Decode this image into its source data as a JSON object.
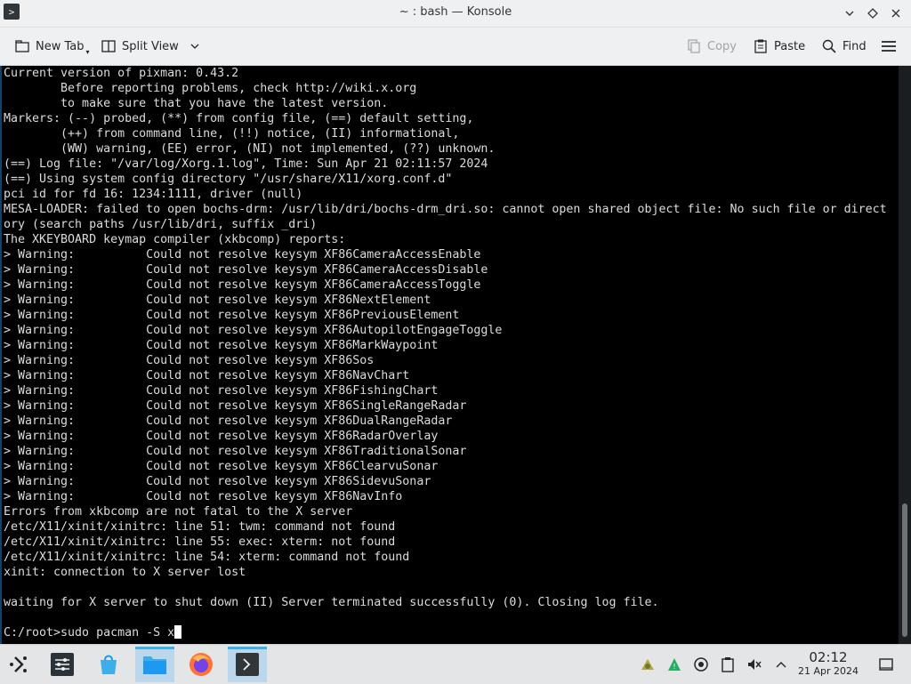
{
  "window": {
    "title": "~ : bash — Konsole",
    "app_icon": "terminal-icon"
  },
  "toolbar": {
    "new_tab": "New Tab",
    "split_view": "Split View",
    "copy": "Copy",
    "paste": "Paste",
    "find": "Find"
  },
  "terminal": {
    "lines": [
      "Current version of pixman: 0.43.2",
      "        Before reporting problems, check http://wiki.x.org",
      "        to make sure that you have the latest version.",
      "Markers: (--) probed, (**) from config file, (==) default setting,",
      "        (++) from command line, (!!) notice, (II) informational,",
      "        (WW) warning, (EE) error, (NI) not implemented, (??) unknown.",
      "(==) Log file: \"/var/log/Xorg.1.log\", Time: Sun Apr 21 02:11:57 2024",
      "(==) Using system config directory \"/usr/share/X11/xorg.conf.d\"",
      "pci id for fd 16: 1234:1111, driver (null)",
      "MESA-LOADER: failed to open bochs-drm: /usr/lib/dri/bochs-drm_dri.so: cannot open shared object file: No such file or direct",
      "ory (search paths /usr/lib/dri, suffix _dri)",
      "The XKEYBOARD keymap compiler (xkbcomp) reports:",
      "> Warning:          Could not resolve keysym XF86CameraAccessEnable",
      "> Warning:          Could not resolve keysym XF86CameraAccessDisable",
      "> Warning:          Could not resolve keysym XF86CameraAccessToggle",
      "> Warning:          Could not resolve keysym XF86NextElement",
      "> Warning:          Could not resolve keysym XF86PreviousElement",
      "> Warning:          Could not resolve keysym XF86AutopilotEngageToggle",
      "> Warning:          Could not resolve keysym XF86MarkWaypoint",
      "> Warning:          Could not resolve keysym XF86Sos",
      "> Warning:          Could not resolve keysym XF86NavChart",
      "> Warning:          Could not resolve keysym XF86FishingChart",
      "> Warning:          Could not resolve keysym XF86SingleRangeRadar",
      "> Warning:          Could not resolve keysym XF86DualRangeRadar",
      "> Warning:          Could not resolve keysym XF86RadarOverlay",
      "> Warning:          Could not resolve keysym XF86TraditionalSonar",
      "> Warning:          Could not resolve keysym XF86ClearvuSonar",
      "> Warning:          Could not resolve keysym XF86SidevuSonar",
      "> Warning:          Could not resolve keysym XF86NavInfo",
      "Errors from xkbcomp are not fatal to the X server",
      "/etc/X11/xinit/xinitrc: line 51: twm: command not found",
      "/etc/X11/xinit/xinitrc: line 55: exec: xterm: not found",
      "/etc/X11/xinit/xinitrc: line 54: xterm: command not found",
      "xinit: connection to X server lost",
      "",
      "waiting for X server to shut down (II) Server terminated successfully (0). Closing log file.",
      ""
    ],
    "prompt": "C:/root>sudo pacman -S x"
  },
  "taskbar": {
    "items": [
      "app-launcher-icon",
      "settings-icon",
      "discover-store-icon",
      "file-manager-icon",
      "firefox-icon",
      "konsole-icon"
    ],
    "tray": [
      "network-tray-icon",
      "update-tray-icon",
      "vault-tray-icon",
      "clipboard-tray-icon",
      "volume-muted-icon",
      "tray-expand-icon"
    ],
    "clock_time": "02:12",
    "clock_date": "21 Apr 2024"
  },
  "colors": {
    "accent": "#3daee9",
    "terminal_bg": "#000000",
    "terminal_fg": "#dcdcdc"
  }
}
